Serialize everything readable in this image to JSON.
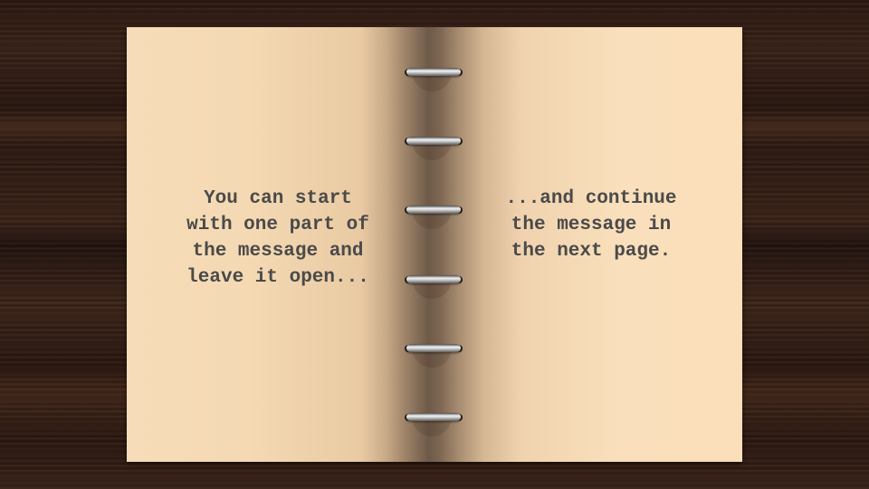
{
  "slide": {
    "left_page_text": "You can start\nwith one part of\nthe message and\nleave it open...",
    "right_page_text": "...and continue\nthe message in\nthe next page."
  },
  "colors": {
    "background_wood": "#2e1a12",
    "paper": "#f6dcb8",
    "spine": "#6e5a48",
    "text": "#4a4a4a",
    "ring": "#e0e0e0"
  },
  "icons": {
    "binding_rings": "spiral-ring-icon"
  }
}
